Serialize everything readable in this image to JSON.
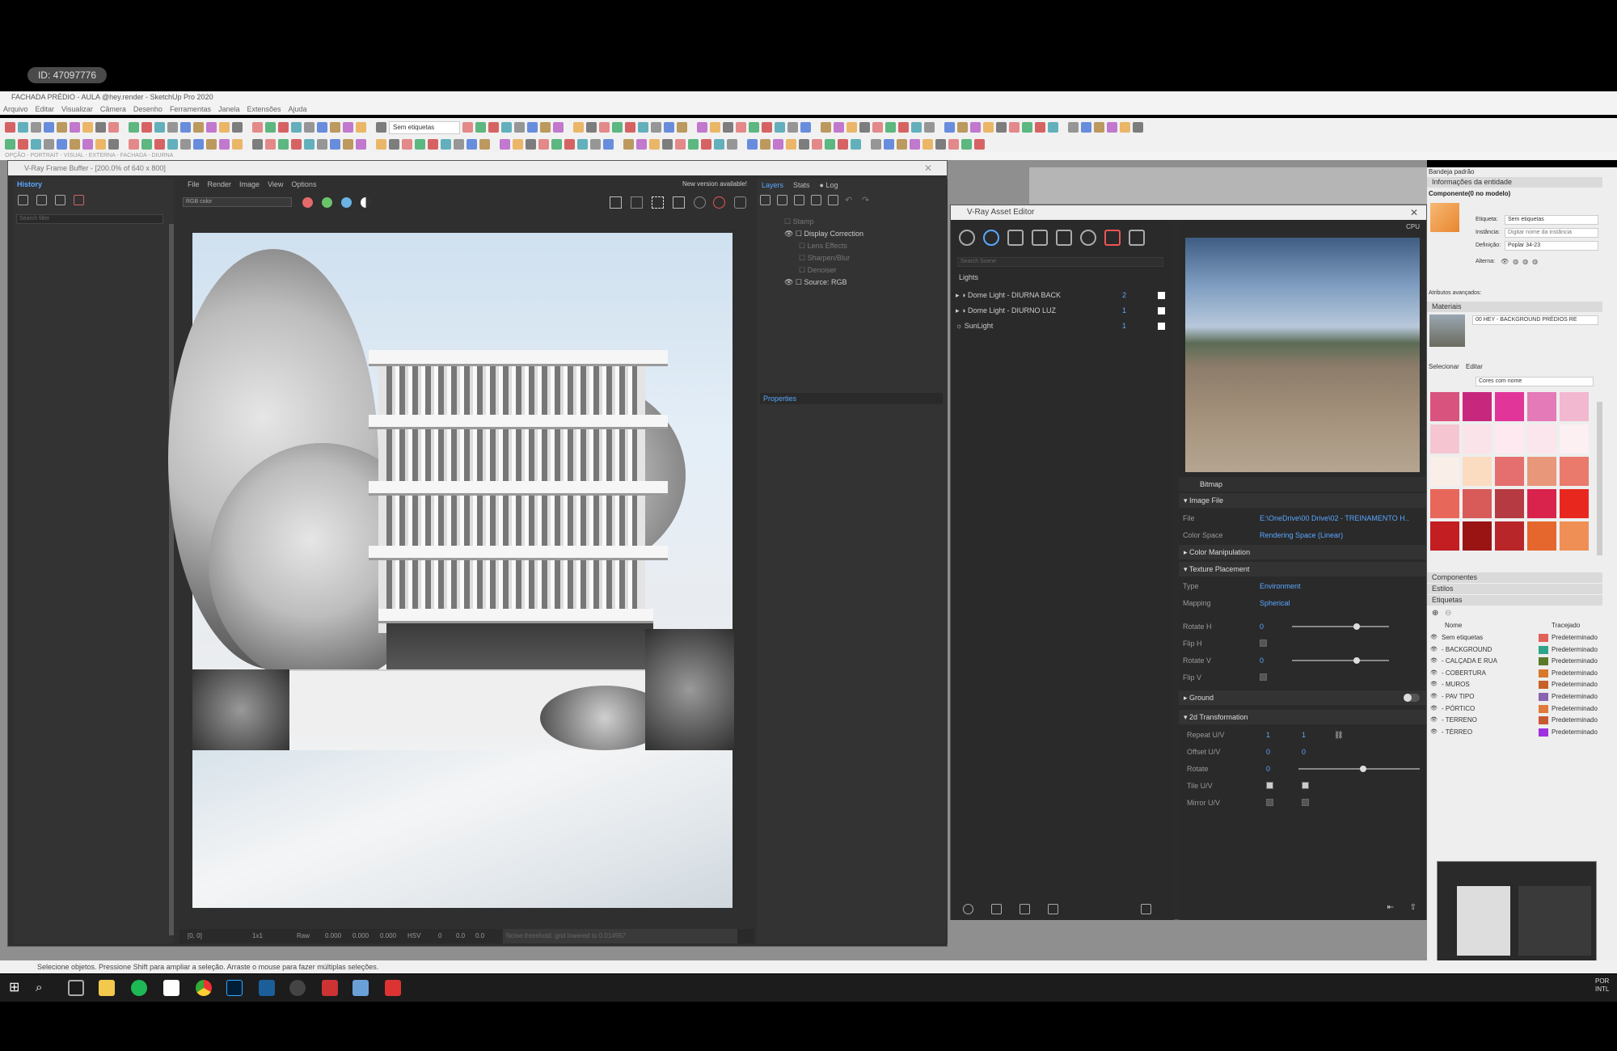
{
  "id_badge": "ID: 47097776",
  "sketchup": {
    "title": "FACHADA PRÉDIO - AULA @hey.render - SketchUp Pro 2020",
    "menu": [
      "Arquivo",
      "Editar",
      "Visualizar",
      "Câmera",
      "Desenho",
      "Ferramentas",
      "Janela",
      "Extensões",
      "Ajuda"
    ],
    "tag_dropdown": "Sem etiquetas",
    "status_small": "OPÇÃO - PORTRAIT - VISUAL - EXTERNA - FACHADA - DIURNA"
  },
  "vfb": {
    "title": "V-Ray Frame Buffer - [200.0% of 640 x 800]",
    "history_label": "History",
    "search_placeholder": "Search filter",
    "menu": [
      "File",
      "Render",
      "Image",
      "View",
      "Options"
    ],
    "new_version": "New version available!",
    "channel": "RGB color",
    "tabs": [
      "Layers",
      "Stats",
      "Log"
    ],
    "layers": [
      {
        "label": "Stamp",
        "dim": true
      },
      {
        "label": "Display Correction",
        "dim": false
      },
      {
        "label": "Lens Effects",
        "dim": true
      },
      {
        "label": "Sharpen/Blur",
        "dim": true
      },
      {
        "label": "Denoiser",
        "dim": true
      },
      {
        "label": "Source: RGB",
        "dim": false
      }
    ],
    "properties_label": "Properties",
    "bottom": {
      "coords": "[0, 0]",
      "zoom": "1x1",
      "mode": "Raw",
      "r": "0.000",
      "g": "0.000",
      "b": "0.000",
      "space": "HSV",
      "v1": "0",
      "v2": "0.0",
      "v3": "0.0",
      "noise_msg": "Noise threshold: grid lowered to 0.014957"
    }
  },
  "asset_editor": {
    "title": "V-Ray Asset Editor",
    "search_placeholder": "Search Scene",
    "lights_label": "Lights",
    "lights": [
      {
        "name": "Dome Light - DIURNA BACK",
        "count": "2"
      },
      {
        "name": "Dome Light - DIURNO LUZ",
        "count": "1"
      },
      {
        "name": "SunLight",
        "count": "1"
      }
    ],
    "cpu_label": "CPU",
    "bitmap_label": "Bitmap",
    "image_file_label": "Image File",
    "file_label": "File",
    "file_value": "E:\\OneDrive\\00 Drive\\02 - TREINAMENTO H...",
    "color_space_label": "Color Space",
    "color_space_value": "Rendering Space (Linear)",
    "color_manip_label": "Color Manipulation",
    "texture_placement_label": "Texture Placement",
    "type_label": "Type",
    "type_value": "Environment",
    "mapping_label": "Mapping",
    "mapping_value": "Spherical",
    "rotate_h_label": "Rotate H",
    "rotate_h_value": "0",
    "flip_h_label": "Flip H",
    "rotate_v_label": "Rotate V",
    "rotate_v_value": "0",
    "flip_v_label": "Flip V",
    "ground_label": "Ground",
    "transform_label": "2d Transformation",
    "repeat_label": "Repeat U/V",
    "repeat_u": "1",
    "repeat_v": "1",
    "offset_label": "Offset U/V",
    "offset_u": "0",
    "offset_v": "0",
    "rotate_label": "Rotate",
    "rotate_value": "0",
    "tile_label": "Tile U/V",
    "mirror_label": "Mirror U/V"
  },
  "tray": {
    "title": "Bandeja padrão",
    "entity_info": "Informações da entidade",
    "component": "Componente(0 no modelo)",
    "etiqueta_label": "Etiqueta:",
    "etiqueta_value": "Sem etiquetas",
    "instancia_label": "Instância:",
    "instancia_placeholder": "Digitar nome da instância",
    "definicao_label": "Definição:",
    "definicao_value": "Poplar 34-23",
    "alterna_label": "Alterna:",
    "atributos": "Atributos avançados:",
    "materiais": "Materiais",
    "material_name": "00 HEY - BACKGROUND PRÉDIOS RE",
    "selecionar": "Selecionar",
    "editar": "Editar",
    "colors_dropdown": "Cores com nome",
    "swatches": [
      "#d9537f",
      "#c7287e",
      "#e2359a",
      "#e57ab8",
      "#f2b8cf",
      "#f5c6d2",
      "#fbe3ea",
      "#fde9ef",
      "#fbe6ee",
      "#fcf0f3",
      "#f9efe8",
      "#fbdcc0",
      "#e56f6f",
      "#e8977b",
      "#ea7a6c",
      "#e8675b",
      "#d85a59",
      "#b53a41",
      "#d9234d",
      "#e8281e",
      "#c31e22",
      "#9a1414",
      "#b8262a",
      "#e5672d",
      "#ef8f55"
    ],
    "componentes": "Componentes",
    "estilos": "Estilos",
    "etiquetas": "Etiquetas",
    "tags_header_name": "Nome",
    "tags_header_trace": "Tracejado",
    "tags": [
      {
        "name": "Sem etiquetas",
        "color": "#e0605a"
      },
      {
        "name": "- BACKGROUND",
        "color": "#2fa38a"
      },
      {
        "name": "- CALÇADA E RUA",
        "color": "#5a7a2a"
      },
      {
        "name": "- COBERTURA",
        "color": "#d8782a"
      },
      {
        "name": "- MUROS",
        "color": "#c8602a"
      },
      {
        "name": "- PAV TIPO",
        "color": "#8a64b0"
      },
      {
        "name": "- PÓRTICO",
        "color": "#e07a3a"
      },
      {
        "name": "- TERRENO",
        "color": "#c85a30"
      },
      {
        "name": "- TÉRREO",
        "color": "#a030e0"
      }
    ],
    "default_label": "Predeterminado"
  },
  "status_message": "Selecione objetos. Pressione Shift para ampliar a seleção. Arraste o mouse para fazer múltiplas seleções.",
  "taskbar": {
    "lang": "POR",
    "layout": "INTL"
  }
}
